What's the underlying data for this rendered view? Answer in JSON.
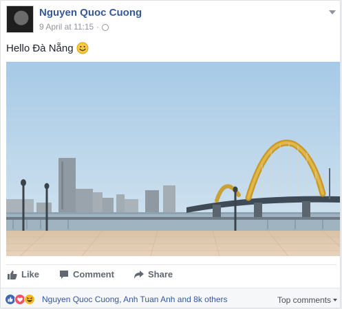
{
  "post": {
    "author": "Nguyen Quoc Cuong",
    "timestamp": "9 April at 11:15",
    "separator": "·",
    "privacy_icon": "globe-icon",
    "text": "Hello Đà Nẵng",
    "emoji_icon": "smiley-icon",
    "image_icon": "photo-dragon-bridge"
  },
  "actions": {
    "like_label": "Like",
    "comment_label": "Comment",
    "share_label": "Share"
  },
  "reactions": {
    "icons": [
      "like-reaction-icon",
      "love-reaction-icon",
      "haha-reaction-icon"
    ],
    "summary": "Nguyen Quoc Cuong, Anh Tuan Anh and 8k others",
    "top_comments_label": "Top comments"
  },
  "colors": {
    "author": "#365899",
    "meta": "#90949c",
    "like_blue": "#4267b2",
    "love_red": "#f25268",
    "haha_yellow": "#f7b928"
  }
}
